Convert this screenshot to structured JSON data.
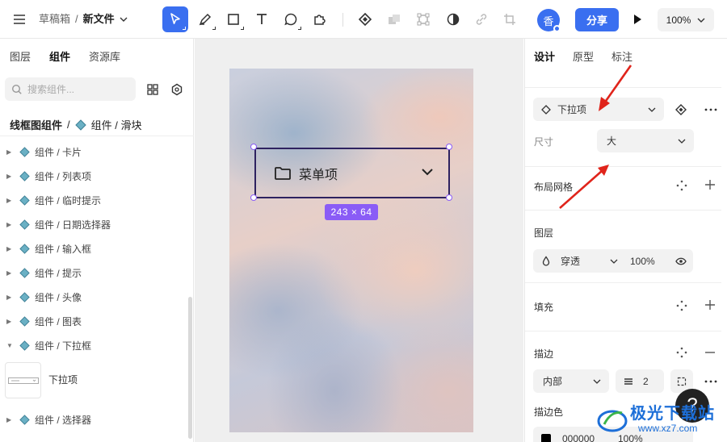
{
  "toolbar": {
    "menu_icon": "hamburger-icon",
    "breadcrumb_root": "草稿箱",
    "breadcrumb_sep": "/",
    "file_name": "新文件",
    "tools": [
      "move-tool",
      "pen-tool",
      "rectangle-tool",
      "text-tool",
      "comment-tool",
      "plugin-tool",
      "component-tool",
      "merge-tool",
      "bounds-tool",
      "mask-tool",
      "link-tool",
      "crop-tool"
    ],
    "avatar_text": "香",
    "share_label": "分享",
    "zoom": "100%"
  },
  "left": {
    "tabs": [
      "图层",
      "组件",
      "资源库"
    ],
    "active_tab": "组件",
    "search_placeholder": "搜索组件...",
    "library_title": "线框图组件",
    "library_sep": "/",
    "library_current": "组件 / 滑块",
    "tree": [
      {
        "label": "组件 / 卡片",
        "expanded": false
      },
      {
        "label": "组件 / 列表项",
        "expanded": false
      },
      {
        "label": "组件 / 临时提示",
        "expanded": false
      },
      {
        "label": "组件 / 日期选择器",
        "expanded": false
      },
      {
        "label": "组件 / 输入框",
        "expanded": false
      },
      {
        "label": "组件 / 提示",
        "expanded": false
      },
      {
        "label": "组件 / 头像",
        "expanded": false
      },
      {
        "label": "组件 / 图表",
        "expanded": false
      },
      {
        "label": "组件 / 下拉框",
        "expanded": true
      }
    ],
    "sub_item_label": "下拉项",
    "tree_last": {
      "label": "组件 / 选择器",
      "expanded": false
    }
  },
  "canvas": {
    "dropdown_label": "菜单项",
    "size_badge": "243 × 64",
    "selection_color": "#8a5cf6"
  },
  "right": {
    "tabs": [
      "设计",
      "原型",
      "标注"
    ],
    "active_tab": "设计",
    "component_name": "下拉项",
    "size_label": "尺寸",
    "size_value": "大",
    "layout_grid_label": "布局网格",
    "layer_label": "图层",
    "blend_mode": "穿透",
    "opacity": "100%",
    "fill_label": "填充",
    "stroke_label": "描边",
    "stroke_position": "内部",
    "stroke_weight": "2",
    "stroke_color_label": "描边色",
    "stroke_color_hex": "000000",
    "stroke_color_opacity": "100%"
  },
  "help_label": "?",
  "watermark": {
    "title": "极光下载站",
    "url": "www.xz7.com"
  },
  "accent_color": "#3a6ff0",
  "annotation_arrow_color": "#e0241b"
}
